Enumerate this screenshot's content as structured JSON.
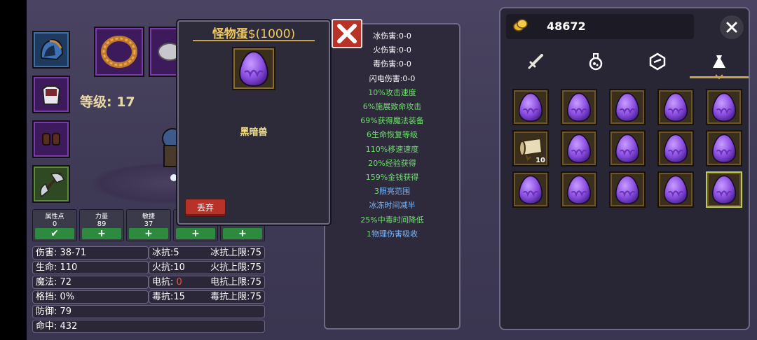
{
  "player": {
    "level_label": "等级: 17"
  },
  "stat_points": [
    {
      "title": "属性点",
      "value": "0",
      "button": "✔"
    },
    {
      "title": "力量",
      "value": "89",
      "button": "+"
    },
    {
      "title": "敏捷",
      "value": "37",
      "button": "+"
    },
    {
      "title": "",
      "value": "",
      "button": "+"
    },
    {
      "title": "",
      "value": "",
      "button": "+"
    }
  ],
  "attributes": {
    "damage": "伤害: 38-71",
    "life": "生命: 110",
    "mana": "魔法: 72",
    "block": "格挡: 0%",
    "defense": "防御: 79",
    "hit": "命中: 432",
    "ice_res": "冰抗:5",
    "fire_res": "火抗:10",
    "elec_res_label": "电抗: ",
    "elec_res_value": "0",
    "poison_res": "毒抗:15",
    "ice_cap": "冰抗上限:75",
    "fire_cap": "火抗上限:75",
    "elec_cap": "电抗上限:75",
    "poison_cap": "毒抗上限:75"
  },
  "popup": {
    "title": "怪物蛋",
    "price": "$(1000)",
    "pet_name": "黑暗兽",
    "drop_button": "丢弃"
  },
  "stats_panel": [
    {
      "num": "",
      "desc": "冰伤害:0-0",
      "style": "white"
    },
    {
      "num": "",
      "desc": "火伤害:0-0",
      "style": "white"
    },
    {
      "num": "",
      "desc": "毒伤害:0-0",
      "style": "white"
    },
    {
      "num": "",
      "desc": "闪电伤害:0-0",
      "style": "white"
    },
    {
      "num": "10%",
      "desc": "攻击速度",
      "style": "green"
    },
    {
      "num": "6%",
      "desc": "施展致命攻击",
      "style": "green"
    },
    {
      "num": "69%",
      "desc": "获得魔法装备",
      "style": "green"
    },
    {
      "num": "6",
      "desc": "生命恢复等级",
      "style": "green"
    },
    {
      "num": "110%",
      "desc": "移速速度",
      "style": "green"
    },
    {
      "num": "20%",
      "desc": "经验获得",
      "style": "green"
    },
    {
      "num": "159%",
      "desc": "金钱获得",
      "style": "green"
    },
    {
      "num": "3",
      "desc": "照亮范围",
      "style": "blue"
    },
    {
      "num": "",
      "desc": "冰冻时间减半",
      "style": "blue"
    },
    {
      "num": "25%",
      "desc": "中毒时间降低",
      "style": "green"
    },
    {
      "num": "1",
      "desc": "物理伤害吸收",
      "style": "blue"
    }
  ],
  "inventory": {
    "gold": "48672",
    "tabs": [
      "weapon-tab",
      "potion-tab",
      "gem-tab",
      "bag-tab"
    ],
    "items": [
      {
        "type": "egg"
      },
      {
        "type": "egg"
      },
      {
        "type": "egg"
      },
      {
        "type": "egg"
      },
      {
        "type": "egg"
      },
      {
        "type": "scroll",
        "count": "10"
      },
      {
        "type": "egg"
      },
      {
        "type": "egg"
      },
      {
        "type": "egg"
      },
      {
        "type": "egg"
      },
      {
        "type": "egg"
      },
      {
        "type": "egg"
      },
      {
        "type": "egg"
      },
      {
        "type": "egg"
      },
      {
        "type": "egg",
        "selected": true
      }
    ]
  },
  "colors": {
    "gold_title": "#f0c860",
    "green_stat": "#6ce06a",
    "blue_stat": "#7ab8ff",
    "red_button": "#b8322a"
  }
}
